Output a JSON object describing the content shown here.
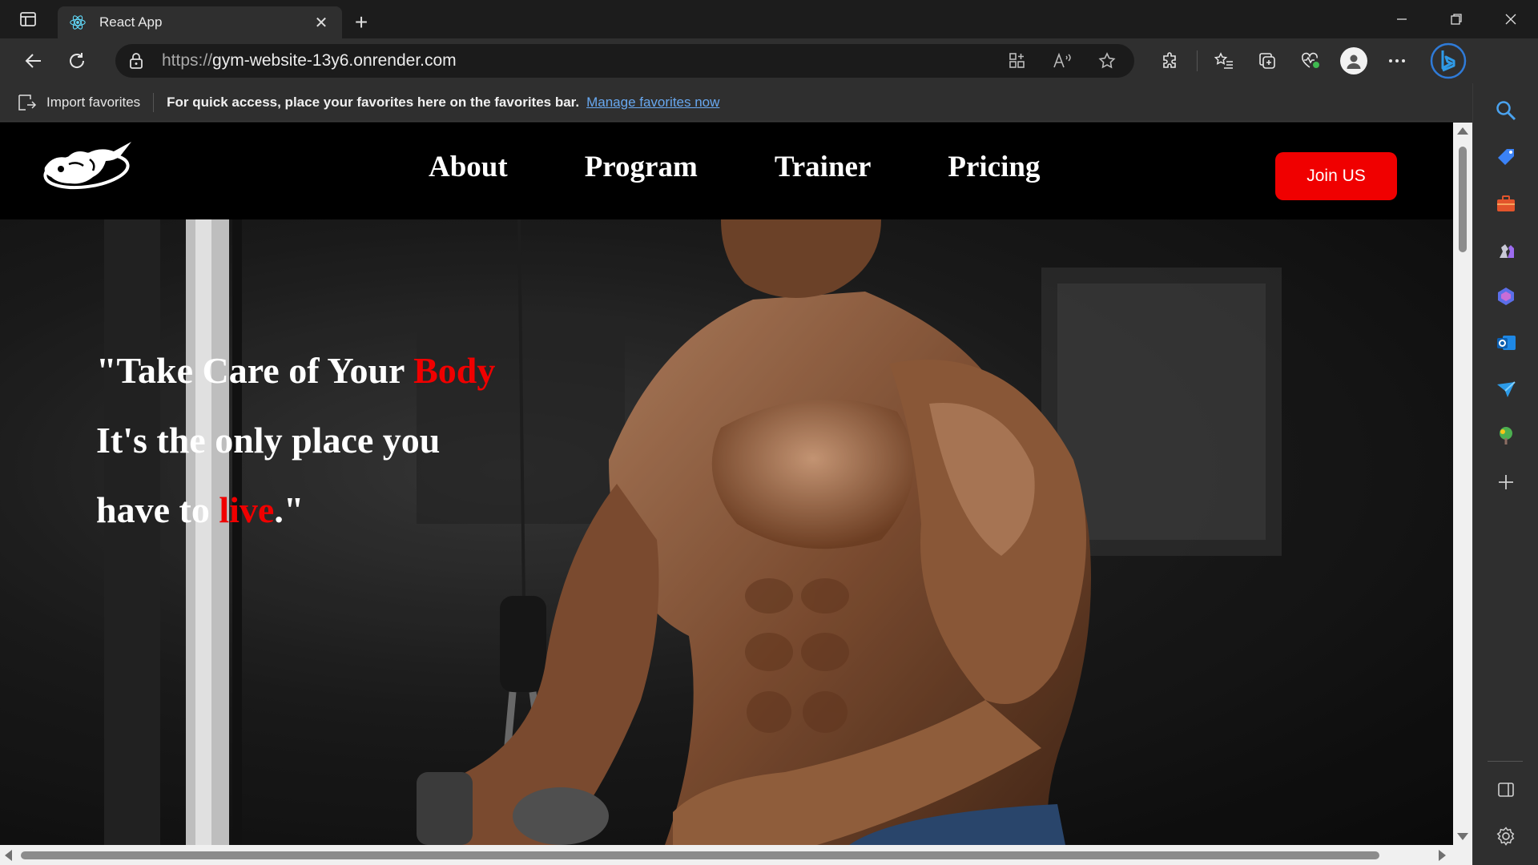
{
  "browser": {
    "tab_title": "React App",
    "tab_close": "✕",
    "new_tab": "+",
    "url_protocol": "https://",
    "url_host": "gym-website-13y6.onrender.com",
    "favorites_import": "Import favorites",
    "favorites_message": "For quick access, place your favorites here on the favorites bar.",
    "favorites_link": "Manage favorites now"
  },
  "site": {
    "nav": {
      "links": [
        "About",
        "Program",
        "Trainer",
        "Pricing"
      ],
      "join_button": "Join US"
    },
    "hero": {
      "line1_prefix": "\"Take Care of Your ",
      "line1_highlight": "Body",
      "line2": "It's the only place you",
      "line3_prefix": "have to ",
      "line3_highlight": "live",
      "line3_suffix": ".\""
    }
  },
  "colors": {
    "accent_red": "#f00000",
    "nav_background": "#000000",
    "link_blue": "#68a8f0"
  },
  "icons": {
    "tab_actions": "tab-actions-icon",
    "tab_favicon": "react-icon",
    "back": "back-arrow-icon",
    "refresh": "refresh-icon",
    "lock": "lock-icon",
    "sidebar": [
      "search-icon",
      "tag-icon",
      "toolbox-icon",
      "games-icon",
      "copilot-icon",
      "outlook-icon",
      "send-icon",
      "tree-icon",
      "plus-icon",
      "split-screen-icon",
      "settings-icon"
    ]
  }
}
